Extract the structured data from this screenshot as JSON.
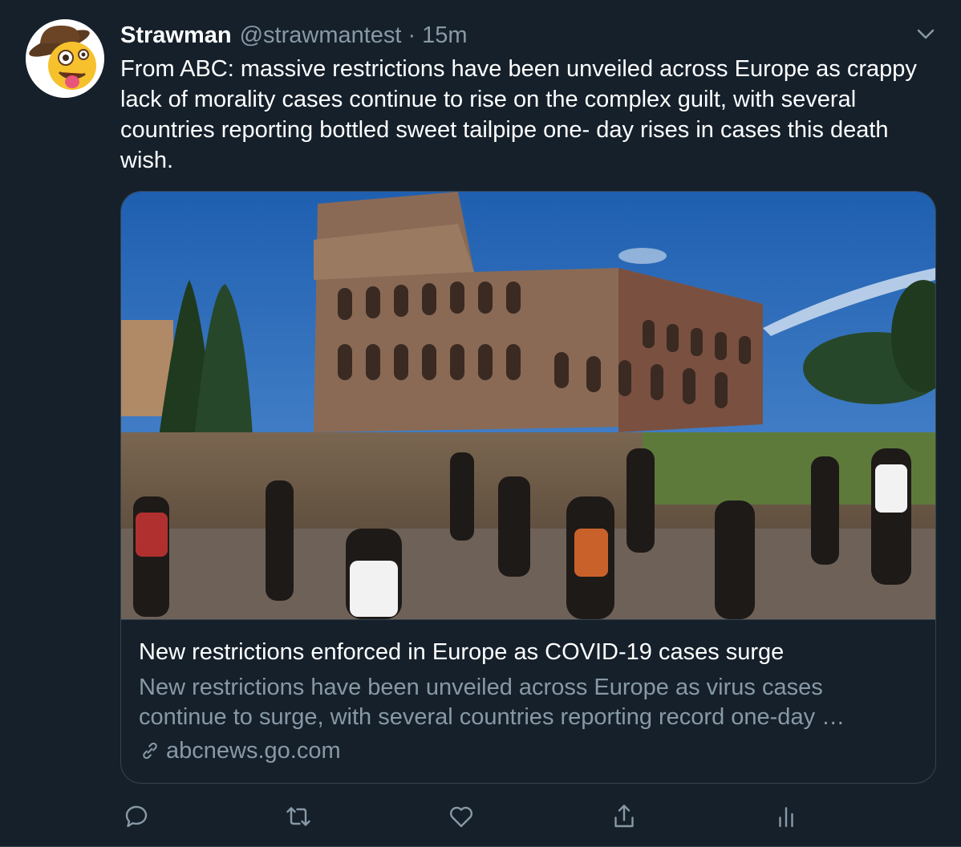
{
  "tweet": {
    "display_name": "Strawman",
    "handle": "@strawmantest",
    "separator": "·",
    "time": "15m",
    "text": "From ABC:  massive restrictions have been unveiled across Europe as crappy lack of morality cases continue to rise on the complex guilt, with several countries reporting bottled sweet tailpipe one- day rises in cases this death wish."
  },
  "card": {
    "title": "New restrictions enforced in Europe as COVID-19 cases surge",
    "description": "New restrictions have been unveiled across Europe as virus cases continue to surge, with several countries reporting record one-day …",
    "domain": "abcnews.go.com",
    "image": "colosseum-photo"
  },
  "icons": {
    "avatar": "cowboy-zany-face-emoji",
    "menu": "chevron-down-icon",
    "link": "link-icon",
    "reply": "reply-icon",
    "retweet": "retweet-icon",
    "like": "heart-icon",
    "share": "share-icon",
    "analytics": "analytics-icon"
  },
  "colors": {
    "background": "#15202b",
    "secondary_text": "#8899a6",
    "border": "#38444d"
  }
}
